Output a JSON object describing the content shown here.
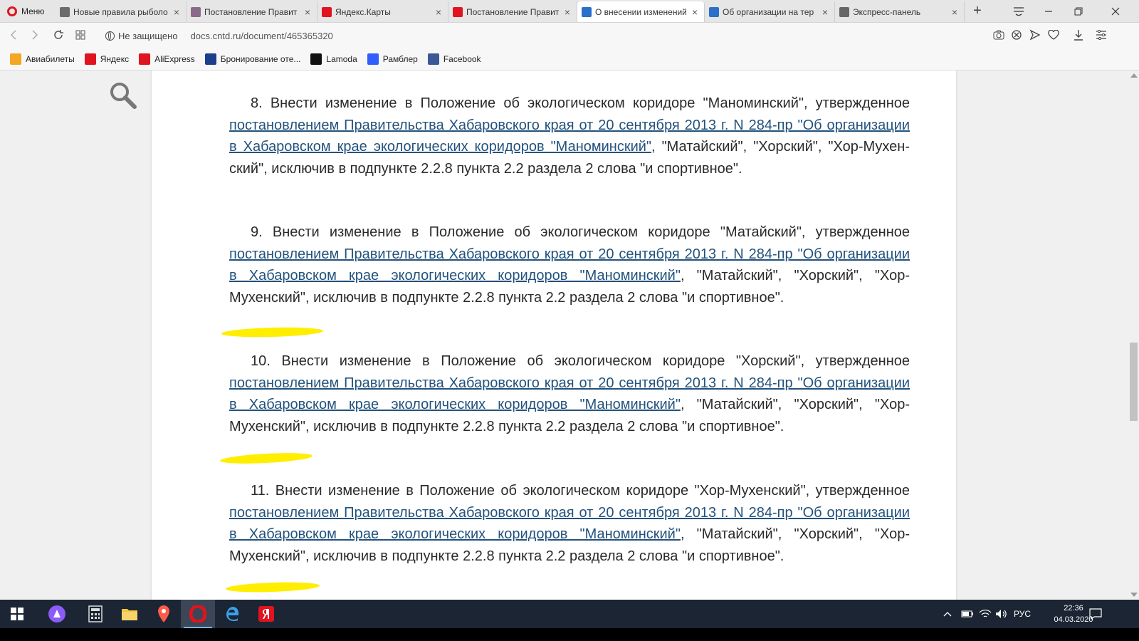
{
  "browser": {
    "menu_label": "Меню",
    "tabs": [
      {
        "title": "Новые правила рыболо",
        "favicon_color": "#6b6b6b",
        "favicon": "doc-favicon-icon",
        "active": false
      },
      {
        "title": "Постановление Правит",
        "favicon_color": "#8a6a8a",
        "favicon": "avatar-favicon-icon",
        "active": false
      },
      {
        "title": "Яндекс.Карты",
        "favicon_color": "#e0141e",
        "favicon": "map-pin-favicon-icon",
        "active": false
      },
      {
        "title": "Постановление Правит",
        "favicon_color": "#e0141e",
        "favicon": "yandex-favicon-icon",
        "active": false
      },
      {
        "title": "О внесении изменений",
        "favicon_color": "#2a6fc9",
        "favicon": "cntd-favicon-icon",
        "active": true
      },
      {
        "title": "Об организации на тер",
        "favicon_color": "#2a6fc9",
        "favicon": "cntd-favicon-icon",
        "active": false
      },
      {
        "title": "Экспресс-панель",
        "favicon_color": "#666666",
        "favicon": "grid-favicon-icon",
        "active": false
      }
    ],
    "address": {
      "security": "Не защищено",
      "url": "docs.cntd.ru/document/465365320"
    },
    "bookmarks": [
      {
        "label": "Авиабилеты",
        "icon": "plane-icon",
        "color": "#f5a623"
      },
      {
        "label": "Яндекс",
        "icon": "yandex-icon",
        "color": "#e0141e"
      },
      {
        "label": "AliExpress",
        "icon": "aliexpress-icon",
        "color": "#e0141e"
      },
      {
        "label": "Бронирование оте...",
        "icon": "booking-icon",
        "color": "#1c3f8c"
      },
      {
        "label": "Lamoda",
        "icon": "lamoda-icon",
        "color": "#111111"
      },
      {
        "label": "Рамблер",
        "icon": "rambler-icon",
        "color": "#315efb"
      },
      {
        "label": "Facebook",
        "icon": "facebook-icon",
        "color": "#3b5998"
      }
    ]
  },
  "document": {
    "paragraphs": [
      {
        "lead": "8. Внести изменение в Положение об экологическом коридоре \"Маноминский\", утвержденное ",
        "link": "постановлением Правительства Хабаровского края от 20 сентября 2013 г. N 284-пр \"Об организации в Хабаровском крае экологических коридоров \"Маноминский\"",
        "tail": ", \"Матайский\", \"Хорский\", \"Хор-Мухен- ский\", исключив в подпункте 2.2.8 пункта 2.2 раздела 2 слова \"и спортивное\"."
      },
      {
        "lead": "9. Внести изменение в Положение об экологическом коридоре \"Матайский\", утвержденное ",
        "link": "постановлением Правительства Хабаровского края от 20 сентября 2013 г. N 284-пр \"Об организации в Хабаровском крае экологических коридоров \"Маноминский\"",
        "tail": ", \"Матайский\", \"Хорский\", \"Хор-Мухенский\", исключив в подпункте 2.2.8 пункта 2.2 раздела 2 слова \"и спортивное\"."
      },
      {
        "lead": "10. Внести изменение в Положение об экологическом коридоре \"Хорский\", утвержденное ",
        "link": "постановлением Правительства Хабаровского края от 20 сентября 2013 г. N 284-пр \"Об организации в Хабаровском крае экологических коридоров \"Маноминский\"",
        "tail": ", \"Матайский\", \"Хорский\", \"Хор-Мухенский\", исключив в подпункте 2.2.8 пункта 2.2 раздела 2 слова \"и спортивное\"."
      },
      {
        "lead": "11. Внести изменение в Положение об экологическом коридоре \"Хор-Мухенский\", утвержденное ",
        "link": "постановлением Правительства Хабаровского края от 20 сентября 2013 г. N 284-пр \"Об организации в Хабаровском крае экологических коридоров \"Маноминский\"",
        "tail": ", \"Матайский\", \"Хорский\", \"Хор-Мухенский\", исключив в подпункте 2.2.8 пункта 2.2 раздела 2 слова \"и спортивное\"."
      }
    ],
    "highlight_color": "#ffee00"
  },
  "taskbar": {
    "language": "РУС",
    "time": "22:36",
    "date": "04.03.2020"
  }
}
